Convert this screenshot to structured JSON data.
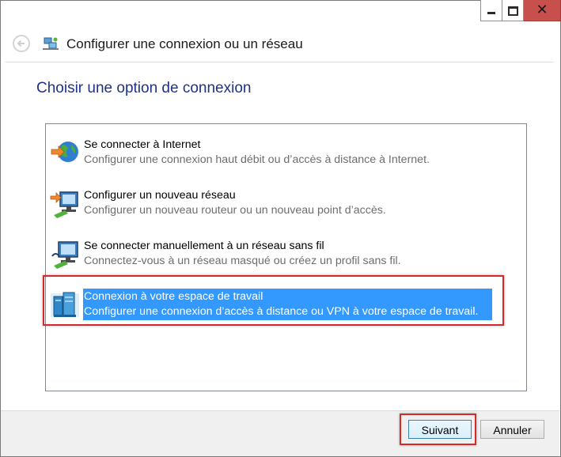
{
  "window": {
    "title": "Configurer une connexion ou un réseau",
    "caption_buttons": [
      "minimize",
      "maximize",
      "close"
    ],
    "close_glyph": "✕"
  },
  "heading": "Choisir une option de connexion",
  "options": [
    {
      "title": "Se connecter à Internet",
      "description": "Configurer une connexion haut débit ou d’accès à distance à Internet.",
      "icon": "internet-globe-icon",
      "selected": false
    },
    {
      "title": "Configurer un nouveau réseau",
      "description": "Configurer un nouveau routeur ou un nouveau point d’accès.",
      "icon": "new-network-icon",
      "selected": false
    },
    {
      "title": "Se connecter manuellement à un réseau sans fil",
      "description": "Connectez-vous à un réseau masqué ou créez un profil sans fil.",
      "icon": "wireless-network-icon",
      "selected": false
    },
    {
      "title": "Connexion à votre espace de travail",
      "description": "Configurer une connexion d’accès à distance ou VPN à votre espace de travail.",
      "icon": "workplace-icon",
      "selected": true
    }
  ],
  "buttons": {
    "next_label": "Suivant",
    "cancel_label": "Annuler"
  },
  "colors": {
    "heading": "#1e3287",
    "selection": "#3399ff",
    "annotation_box": "#d32b2b",
    "close_button": "#c7504d"
  }
}
